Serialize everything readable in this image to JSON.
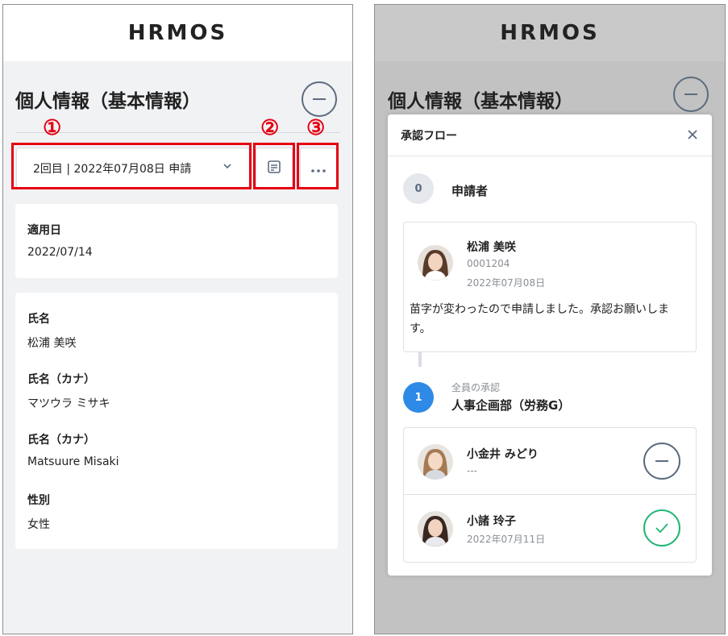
{
  "app": {
    "logo": "HRMOS"
  },
  "left": {
    "page_title": "個人情報（基本情報）",
    "markers": [
      "①",
      "②",
      "③"
    ],
    "application_select": {
      "value": "2回目 | 2022年07月08日 申請"
    },
    "icons": {
      "memo": "memo-icon",
      "more": "more-icon",
      "chevron": "chevron-down-icon",
      "collapse": "minus-circle-icon"
    },
    "applied_date": {
      "label": "適用日",
      "value": "2022/07/14"
    },
    "fields": [
      {
        "label": "氏名",
        "value": "松浦 美咲"
      },
      {
        "label": "氏名（カナ）",
        "value": "マツウラ ミサキ"
      },
      {
        "label": "氏名（カナ）",
        "value": "Matsuure Misaki"
      },
      {
        "label": "性別",
        "value": "女性"
      }
    ]
  },
  "right": {
    "page_title": "個人情報（基本情報）",
    "modal": {
      "title": "承認フロー",
      "applicant_step": {
        "number": "0",
        "label": "申請者"
      },
      "applicant": {
        "name": "松浦 美咲",
        "employee_id": "0001204",
        "date": "2022年07月08日",
        "comment": "苗字が変わったので申請しました。承認お願いします。"
      },
      "approval_step": {
        "number": "1",
        "type": "全員の承認",
        "department": "人事企画部（労務G）"
      },
      "approvers": [
        {
          "name": "小金井 みどり",
          "date": "---",
          "status": "pending",
          "status_icon": "minus-circle-icon"
        },
        {
          "name": "小諸 玲子",
          "date": "2022年07月11日",
          "status": "approved",
          "status_icon": "check-circle-icon"
        }
      ]
    }
  },
  "colors": {
    "annotation_red": "#e60012",
    "step_blue": "#2e8ae6",
    "approved_green": "#21b574",
    "icon_gray": "#5c6b7e"
  }
}
